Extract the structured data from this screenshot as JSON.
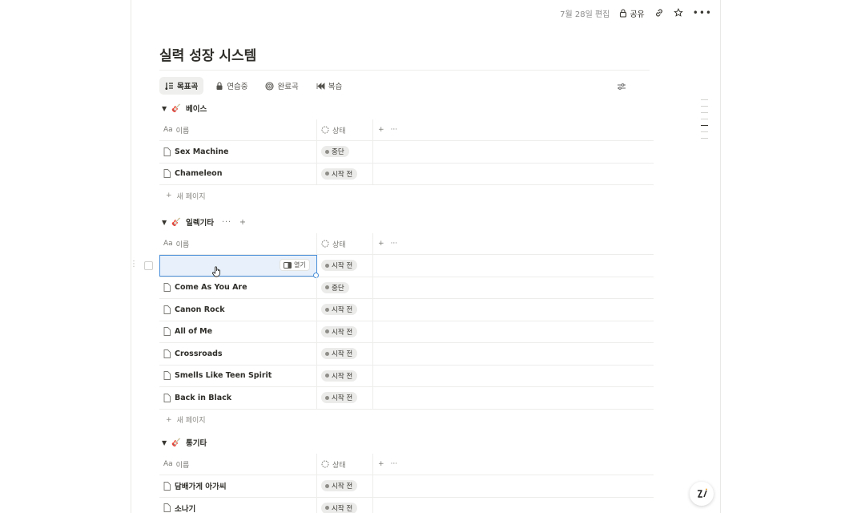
{
  "topbar": {
    "edited": "7월 28일 편집",
    "share_label": "공유"
  },
  "page": {
    "title": "실력 성장 시스템"
  },
  "tabs": [
    {
      "label": "목표곡",
      "icon": "music-list-icon"
    },
    {
      "label": "연습중",
      "icon": "lock-icon"
    },
    {
      "label": "완료곡",
      "icon": "target-icon"
    },
    {
      "label": "복습",
      "icon": "rewind-icon"
    }
  ],
  "columns": {
    "name": "이름",
    "status": "상태",
    "name_prefix": "Aa"
  },
  "new_page_label": "새 페이지",
  "open_label": "열기",
  "groups": [
    {
      "name": "베이스",
      "rows": [
        {
          "name": "Sex Machine",
          "status": "중단"
        },
        {
          "name": "Chameleon",
          "status": "시작 전"
        }
      ]
    },
    {
      "name": "일렉기타",
      "rows": [
        {
          "name": "",
          "status": "시작 전"
        },
        {
          "name": "Come As You Are",
          "status": "중단"
        },
        {
          "name": "Canon Rock",
          "status": "시작 전"
        },
        {
          "name": "All of Me",
          "status": "시작 전"
        },
        {
          "name": "Crossroads",
          "status": "시작 전"
        },
        {
          "name": "Smells Like Teen Spirit",
          "status": "시작 전"
        },
        {
          "name": "Back in Black",
          "status": "시작 전"
        }
      ]
    },
    {
      "name": "통기타",
      "rows": [
        {
          "name": "담배가게 아가씨",
          "status": "시작 전"
        },
        {
          "name": "소나기",
          "status": "시작 전"
        }
      ]
    }
  ],
  "colors": {
    "selection": "#4a90d9",
    "pill_bg": "#ebebea",
    "text": "#37352f"
  }
}
